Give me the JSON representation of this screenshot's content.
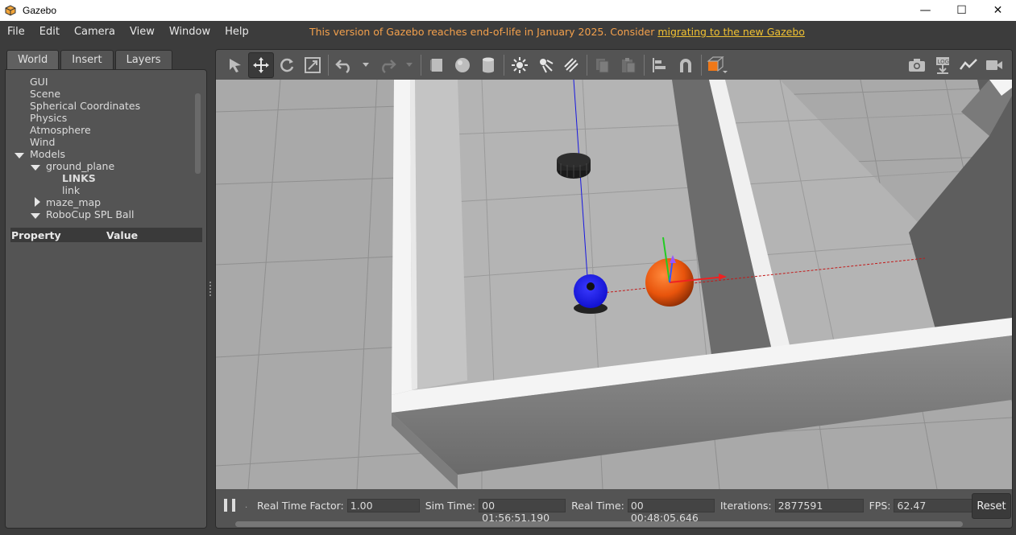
{
  "window": {
    "title": "Gazebo",
    "minimize": "—",
    "maximize": "☐",
    "close": "✕"
  },
  "menu": {
    "items": [
      "File",
      "Edit",
      "Camera",
      "View",
      "Window",
      "Help"
    ],
    "eol_notice": "This version of Gazebo reaches end-of-life in January 2025. Consider ",
    "eol_link": "migrating to the new Gazebo"
  },
  "left_panel": {
    "tabs": [
      "World",
      "Insert",
      "Layers"
    ],
    "active_tab": "World",
    "tree": [
      {
        "label": "GUI"
      },
      {
        "label": "Scene"
      },
      {
        "label": "Spherical Coordinates"
      },
      {
        "label": "Physics"
      },
      {
        "label": "Atmosphere"
      },
      {
        "label": "Wind"
      },
      {
        "label": "Models"
      },
      {
        "label": "ground_plane"
      },
      {
        "label": "LINKS"
      },
      {
        "label": "link"
      },
      {
        "label": "maze_map"
      },
      {
        "label": "RoboCup SPL Ball"
      }
    ],
    "property_header": {
      "property": "Property",
      "value": "Value"
    }
  },
  "toolbar": {
    "tools": [
      "select-icon",
      "translate-icon",
      "rotate-icon",
      "scale-icon",
      "undo-icon",
      "redo-icon",
      "box-icon",
      "sphere-icon",
      "cylinder-icon",
      "point-light-icon",
      "spot-light-icon",
      "directional-light-icon",
      "copy-icon",
      "paste-icon",
      "align-icon",
      "snap-icon",
      "view-angle-icon"
    ],
    "right_tools": [
      "screenshot-icon",
      "log-icon",
      "plot-icon",
      "record-video-icon"
    ],
    "active_tool": "translate-icon"
  },
  "statusbar": {
    "rtf_label": "Real Time Factor:",
    "rtf_value": "1.00",
    "sim_time_label": "Sim Time:",
    "sim_time_value": "00 01:56:51.190",
    "real_time_label": "Real Time:",
    "real_time_value": "00 00:48:05.646",
    "iterations_label": "Iterations:",
    "iterations_value": "2877591",
    "fps_label": "FPS:",
    "fps_value": "62.47",
    "reset_label": "Reset"
  },
  "colors": {
    "eol_text": "#f3a04c",
    "eol_link": "#f1c232",
    "ball": "#e8540c",
    "robot": "#1212f0"
  }
}
